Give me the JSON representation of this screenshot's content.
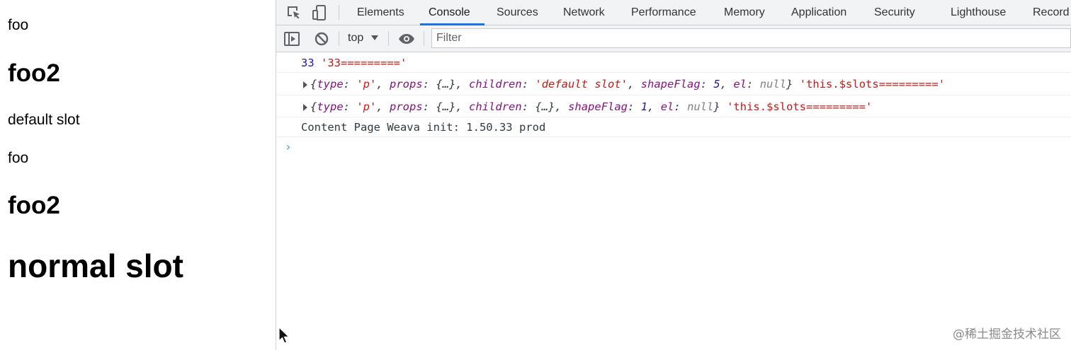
{
  "page": {
    "line1": "foo",
    "heading1": "foo2",
    "line2": "default slot",
    "line3": "foo",
    "heading2": "foo2",
    "heading3": "normal slot"
  },
  "devtools": {
    "tabs": [
      "Elements",
      "Console",
      "Sources",
      "Network",
      "Performance",
      "Memory",
      "Application",
      "Security",
      "Lighthouse",
      "Record"
    ],
    "active_tab": "Console",
    "toolbar": {
      "context": "top",
      "filter_placeholder": "Filter",
      "filter_value": ""
    },
    "console": {
      "line1": {
        "number": "33",
        "string": "'33========='"
      },
      "line2": {
        "type_key": "type",
        "type_val": "'p'",
        "props_key": "props",
        "props_val": "{…}",
        "children_key": "children",
        "children_val": "'default slot'",
        "shapeFlag_key": "shapeFlag",
        "shapeFlag_val": "5",
        "el_key": "el",
        "el_val": "null",
        "suffix": "'this.$slots========='"
      },
      "line3": {
        "type_key": "type",
        "type_val": "'p'",
        "props_key": "props",
        "props_val": "{…}",
        "children_key": "children",
        "children_val": "{…}",
        "shapeFlag_key": "shapeFlag",
        "shapeFlag_val": "1",
        "el_key": "el",
        "el_val": "null",
        "suffix": "'this.$slots========='"
      },
      "line4": "Content Page Weava init: 1.50.33 prod",
      "prompt": "›"
    }
  },
  "watermark": "@稀土掘金技术社区",
  "colors": {
    "accent": "#1a73e8",
    "string": "#c41a16",
    "number": "#1a1aa6",
    "toolbar_bg": "#f1f3f4"
  },
  "icons": [
    "inspect-element-icon",
    "device-toolbar-icon",
    "sidebar-toggle-icon",
    "clear-console-icon",
    "dropdown-arrow-icon",
    "eye-icon",
    "expand-triangle-icon",
    "mouse-cursor-icon"
  ]
}
